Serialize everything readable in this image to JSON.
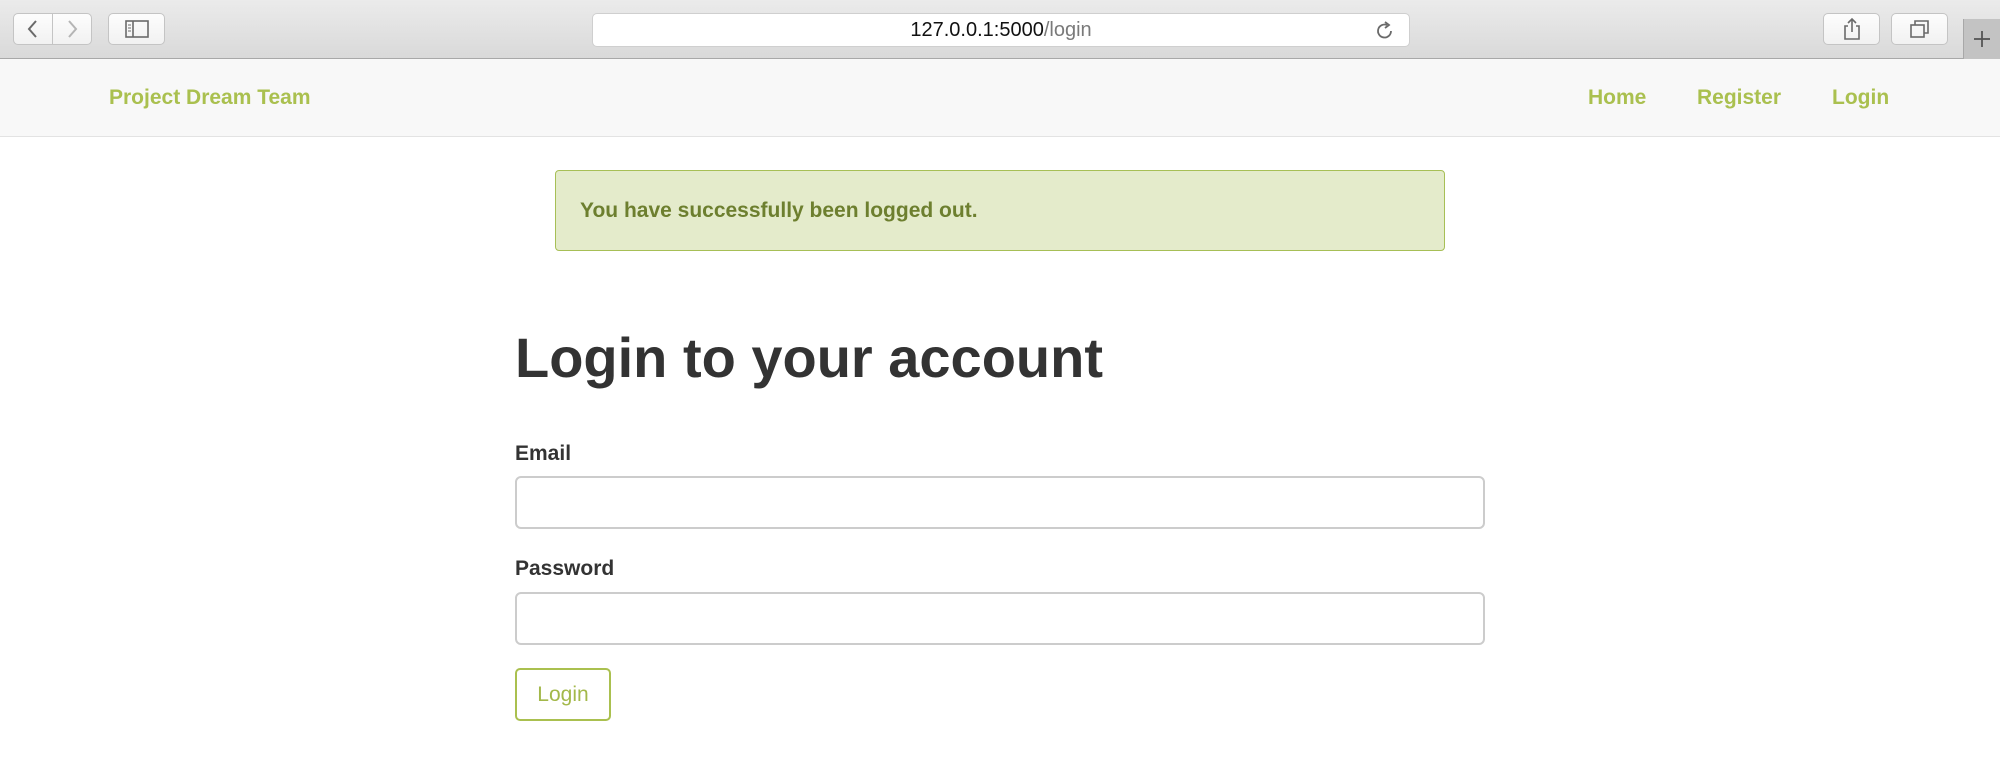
{
  "browser": {
    "url_host": "127.0.0.1:5000",
    "url_path": "/login"
  },
  "navbar": {
    "brand": "Project Dream Team",
    "links": [
      {
        "label": "Home"
      },
      {
        "label": "Register"
      },
      {
        "label": "Login"
      }
    ],
    "link_color": "#aac04f"
  },
  "alert": {
    "message": "You have successfully been logged out.",
    "background": "#e4ebcb",
    "border": "#a7bf56"
  },
  "form": {
    "title": "Login to your account",
    "email_label": "Email",
    "email_value": "",
    "password_label": "Password",
    "password_value": "",
    "submit_label": "Login"
  }
}
